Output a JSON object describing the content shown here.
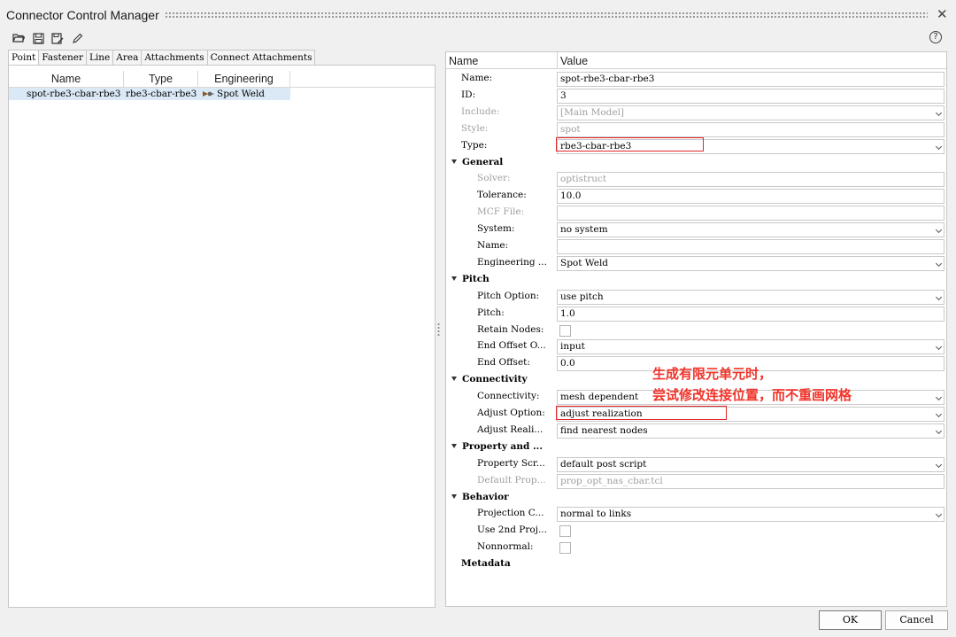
{
  "window": {
    "title": "Connector Control Manager",
    "close_glyph": "✕"
  },
  "toolbar": {
    "icons": [
      "open-folder-icon",
      "save-icon",
      "save-as-icon",
      "edit-pencil-icon"
    ],
    "help_glyph": "?"
  },
  "tabs": [
    "Point",
    "Fastener",
    "Line",
    "Area",
    "Attachments",
    "Connect Attachments"
  ],
  "list": {
    "columns": [
      "Name",
      "Type",
      "Engineering Name"
    ],
    "rows": [
      {
        "name": "spot-rbe3-cbar-rbe3",
        "type": "rbe3-cbar-rbe3",
        "engineering_name": "Spot Weld"
      }
    ]
  },
  "properties": {
    "header": {
      "name": "Name",
      "value": "Value"
    },
    "rows": [
      {
        "kind": "prop",
        "label": "Name:",
        "value": "spot-rbe3-cbar-rbe3",
        "control": "text"
      },
      {
        "kind": "prop",
        "label": "ID:",
        "value": "3",
        "control": "text"
      },
      {
        "kind": "prop",
        "label": "Include:",
        "value": "[Main Model]",
        "control": "select",
        "dim": true
      },
      {
        "kind": "prop",
        "label": "Style:",
        "value": "spot",
        "control": "text",
        "dim": true
      },
      {
        "kind": "prop",
        "label": "Type:",
        "value": "rbe3-cbar-rbe3",
        "control": "select"
      },
      {
        "kind": "section",
        "label": "General"
      },
      {
        "kind": "prop",
        "label": "Solver:",
        "value": "optistruct",
        "control": "text",
        "dim": true,
        "indent": true
      },
      {
        "kind": "prop",
        "label": "Tolerance:",
        "value": "10.0",
        "control": "text",
        "indent": true
      },
      {
        "kind": "prop",
        "label": "MCF File:",
        "value": "",
        "control": "text",
        "dim": true,
        "indent": true
      },
      {
        "kind": "prop",
        "label": "System:",
        "value": "no system",
        "control": "select",
        "indent": true
      },
      {
        "kind": "prop",
        "label": "Name:",
        "value": "",
        "control": "text",
        "indent": true
      },
      {
        "kind": "prop",
        "label": "Engineering ...",
        "value": "Spot Weld",
        "control": "select",
        "indent": true
      },
      {
        "kind": "section",
        "label": "Pitch"
      },
      {
        "kind": "prop",
        "label": "Pitch Option:",
        "value": "use pitch",
        "control": "select",
        "indent": true
      },
      {
        "kind": "prop",
        "label": "Pitch:",
        "value": "1.0",
        "control": "text",
        "indent": true
      },
      {
        "kind": "prop",
        "label": "Retain Nodes:",
        "value": "",
        "control": "checkbox",
        "indent": true
      },
      {
        "kind": "prop",
        "label": "End Offset O...",
        "value": "input",
        "control": "select",
        "indent": true
      },
      {
        "kind": "prop",
        "label": "End Offset:",
        "value": "0.0",
        "control": "text",
        "indent": true
      },
      {
        "kind": "section",
        "label": "Connectivity"
      },
      {
        "kind": "prop",
        "label": "Connectivity:",
        "value": "mesh dependent",
        "control": "select",
        "indent": true
      },
      {
        "kind": "prop",
        "label": "Adjust Option:",
        "value": "adjust realization",
        "control": "select",
        "indent": true
      },
      {
        "kind": "prop",
        "label": "Adjust Reali...",
        "value": "find nearest nodes",
        "control": "select",
        "indent": true
      },
      {
        "kind": "section",
        "label": "Property and ..."
      },
      {
        "kind": "prop",
        "label": "Property Scr...",
        "value": "default post script",
        "control": "select",
        "indent": true
      },
      {
        "kind": "prop",
        "label": "Default Prop...",
        "value": "prop_opt_nas_cbar.tcl",
        "control": "text",
        "dim": true,
        "indent": true
      },
      {
        "kind": "section",
        "label": "Behavior"
      },
      {
        "kind": "prop",
        "label": "Projection C...",
        "value": "normal to links",
        "control": "select",
        "indent": true
      },
      {
        "kind": "prop",
        "label": "Use 2nd Proj...",
        "value": "",
        "control": "checkbox",
        "indent": true
      },
      {
        "kind": "prop",
        "label": "Nonnormal:",
        "value": "",
        "control": "checkbox",
        "indent": true
      },
      {
        "kind": "section",
        "label": "Metadata",
        "no_arrow": true
      }
    ]
  },
  "annotation": {
    "lines": [
      "生成有限元单元时，",
      "尝试修改连接位置，而不重画网格"
    ],
    "color": "#f0342a"
  },
  "buttons": {
    "ok": "OK",
    "cancel": "Cancel"
  }
}
